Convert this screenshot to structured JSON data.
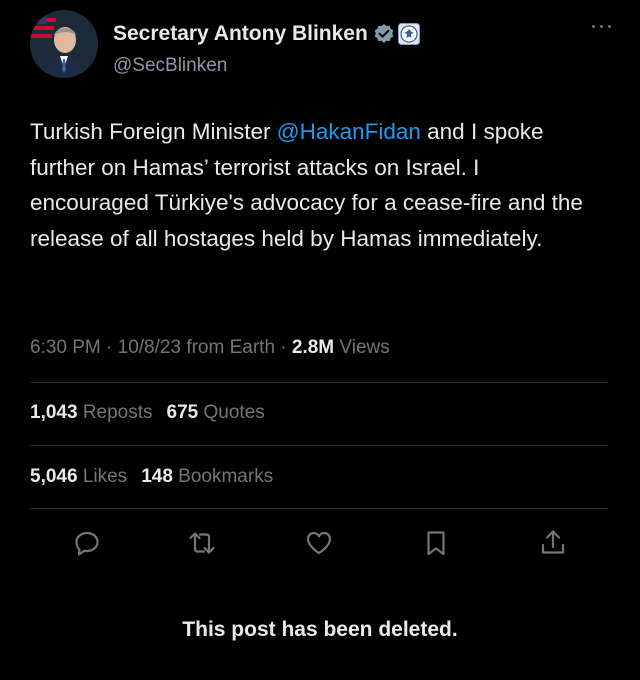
{
  "author": {
    "display_name": "Secretary Antony Blinken",
    "handle": "@SecBlinken"
  },
  "tweet": {
    "text_before": "Turkish Foreign Minister ",
    "mention": "@HakanFidan",
    "text_after": " and I spoke further on Hamas’ terrorist attacks on Israel. I encouraged Türkiye's advocacy for a cease-fire and the release of all hostages held by Hamas immediately."
  },
  "meta": {
    "timestamp": "6:30 PM · 10/8/23 from Earth · ",
    "views_count": "2.8M",
    "views_label": " Views"
  },
  "stats": {
    "reposts_count": "1,043",
    "reposts_label": "Reposts",
    "quotes_count": "675",
    "quotes_label": "Quotes",
    "likes_count": "5,046",
    "likes_label": "Likes",
    "bookmarks_count": "148",
    "bookmarks_label": "Bookmarks"
  },
  "icons": {
    "reply": "reply-icon",
    "repost": "repost-icon",
    "like": "like-icon",
    "bookmark": "bookmark-icon",
    "share": "share-icon",
    "verified": "verified-badge-icon",
    "affiliation": "state-department-seal-icon"
  },
  "notice": "This post has been deleted.",
  "colors": {
    "background": "#000000",
    "text": "#e7e9ea",
    "secondary": "#71767b",
    "accent": "#1d9bf0",
    "divider": "#2f3336"
  }
}
